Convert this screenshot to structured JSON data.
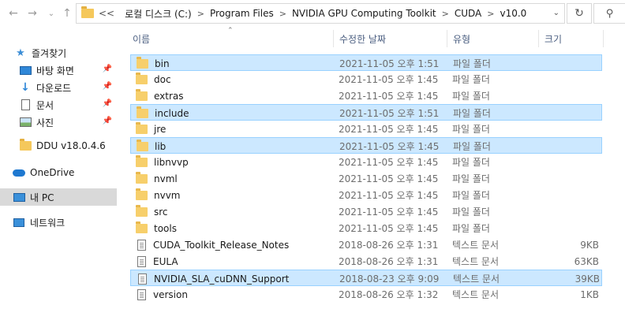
{
  "address_bar": {
    "overflow": "<<",
    "crumbs": [
      "로컬 디스크 (C:)",
      "Program Files",
      "NVIDIA GPU Computing Toolkit",
      "CUDA",
      "v10.0"
    ],
    "separator": ">"
  },
  "columns": {
    "name": "이름",
    "date": "수정한 날짜",
    "type": "유형",
    "size": "크기"
  },
  "nav": {
    "items": [
      {
        "label": "즐겨찾기",
        "icon": "star-icon"
      },
      {
        "label": "바탕 화면",
        "icon": "desktop-icon",
        "pinned": true
      },
      {
        "label": "다운로드",
        "icon": "download-icon",
        "pinned": true
      },
      {
        "label": "문서",
        "icon": "document-icon",
        "pinned": true
      },
      {
        "label": "사진",
        "icon": "picture-icon",
        "pinned": true
      },
      {
        "label": "DDU v18.0.4.6",
        "icon": "folder-icon"
      },
      {
        "label": "OneDrive",
        "icon": "onedrive-icon"
      },
      {
        "label": "내 PC",
        "icon": "pc-icon",
        "selected": true
      },
      {
        "label": "네트워크",
        "icon": "network-icon"
      }
    ]
  },
  "files": [
    {
      "name": "bin",
      "date": "2021-11-05 오후 1:51",
      "type": "파일 폴더",
      "size": "",
      "kind": "folder",
      "selected": true
    },
    {
      "name": "doc",
      "date": "2021-11-05 오후 1:45",
      "type": "파일 폴더",
      "size": "",
      "kind": "folder"
    },
    {
      "name": "extras",
      "date": "2021-11-05 오후 1:45",
      "type": "파일 폴더",
      "size": "",
      "kind": "folder"
    },
    {
      "name": "include",
      "date": "2021-11-05 오후 1:51",
      "type": "파일 폴더",
      "size": "",
      "kind": "folder",
      "selected": true
    },
    {
      "name": "jre",
      "date": "2021-11-05 오후 1:45",
      "type": "파일 폴더",
      "size": "",
      "kind": "folder"
    },
    {
      "name": "lib",
      "date": "2021-11-05 오후 1:45",
      "type": "파일 폴더",
      "size": "",
      "kind": "folder",
      "selected": true
    },
    {
      "name": "libnvvp",
      "date": "2021-11-05 오후 1:45",
      "type": "파일 폴더",
      "size": "",
      "kind": "folder"
    },
    {
      "name": "nvml",
      "date": "2021-11-05 오후 1:45",
      "type": "파일 폴더",
      "size": "",
      "kind": "folder"
    },
    {
      "name": "nvvm",
      "date": "2021-11-05 오후 1:45",
      "type": "파일 폴더",
      "size": "",
      "kind": "folder"
    },
    {
      "name": "src",
      "date": "2021-11-05 오후 1:45",
      "type": "파일 폴더",
      "size": "",
      "kind": "folder"
    },
    {
      "name": "tools",
      "date": "2021-11-05 오후 1:45",
      "type": "파일 폴더",
      "size": "",
      "kind": "folder"
    },
    {
      "name": "CUDA_Toolkit_Release_Notes",
      "date": "2018-08-26 오후 1:31",
      "type": "텍스트 문서",
      "size": "9KB",
      "kind": "file"
    },
    {
      "name": "EULA",
      "date": "2018-08-26 오후 1:31",
      "type": "텍스트 문서",
      "size": "63KB",
      "kind": "file"
    },
    {
      "name": "NVIDIA_SLA_cuDNN_Support",
      "date": "2018-08-23 오후 9:09",
      "type": "텍스트 문서",
      "size": "39KB",
      "kind": "file",
      "selected": true
    },
    {
      "name": "version",
      "date": "2018-08-26 오후 1:32",
      "type": "텍스트 문서",
      "size": "1KB",
      "kind": "file"
    }
  ]
}
